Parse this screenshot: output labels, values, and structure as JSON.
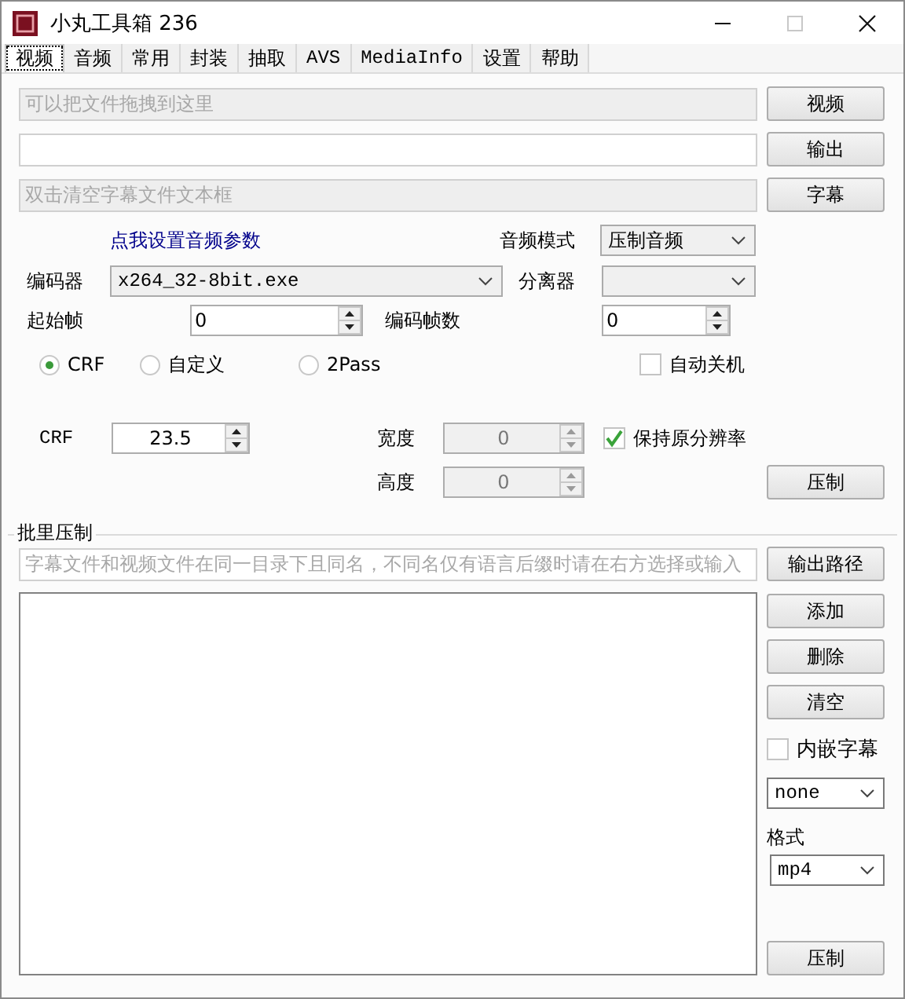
{
  "window": {
    "title": "小丸工具箱 236"
  },
  "tabs": [
    {
      "label": "视频",
      "selected": true
    },
    {
      "label": "音频",
      "selected": false
    },
    {
      "label": "常用",
      "selected": false
    },
    {
      "label": "封装",
      "selected": false
    },
    {
      "label": "抽取",
      "selected": false
    },
    {
      "label": "AVS",
      "selected": false
    },
    {
      "label": "MediaInfo",
      "selected": false
    },
    {
      "label": "设置",
      "selected": false
    },
    {
      "label": "帮助",
      "selected": false
    }
  ],
  "file_rows": [
    {
      "placeholder": "可以把文件拖拽到这里",
      "disabled": true,
      "button": "视频"
    },
    {
      "disabled": false,
      "button": "输出"
    },
    {
      "placeholder": "双击清空字幕文件文本框",
      "disabled": true,
      "button": "字幕"
    }
  ],
  "audio_settings_link": "点我设置音频参数",
  "audio_mode": {
    "label": "音频模式",
    "value": "压制音频"
  },
  "encoder": {
    "label": "编码器",
    "value": "x264_32-8bit.exe"
  },
  "splitter": {
    "label": "分离器"
  },
  "start_frame": {
    "label": "起始帧",
    "value": "0"
  },
  "frame_count": {
    "label": "编码帧数",
    "value": "0"
  },
  "modes": [
    {
      "label": "CRF",
      "selected": true
    },
    {
      "label": "自定义",
      "selected": false
    },
    {
      "label": "2Pass",
      "selected": false
    }
  ],
  "auto_shutdown": {
    "label": "自动关机",
    "checked": false
  },
  "crf": {
    "label": "CRF",
    "value": "23.5"
  },
  "width": {
    "label": "宽度",
    "value": "0",
    "disabled": true
  },
  "height": {
    "label": "高度",
    "value": "0",
    "disabled": true
  },
  "keep_resolution": {
    "label": "保持原分辨率",
    "checked": true
  },
  "encode_button": "压制",
  "batch": {
    "title": "批里压制",
    "hint": {
      "placeholder": "字幕文件和视频文件在同一目录下且同名，不同名仅有语言后缀时请在右方选择或输入"
    },
    "output_path_button": "输出路径",
    "buttons": [
      "添加",
      "删除",
      "清空"
    ],
    "embed_subtitles": {
      "label": "内嵌字幕",
      "checked": false
    },
    "subtitle_language": {
      "value": "none"
    },
    "format": {
      "label": "格式",
      "value": "mp4"
    },
    "encode_button": "压制"
  }
}
